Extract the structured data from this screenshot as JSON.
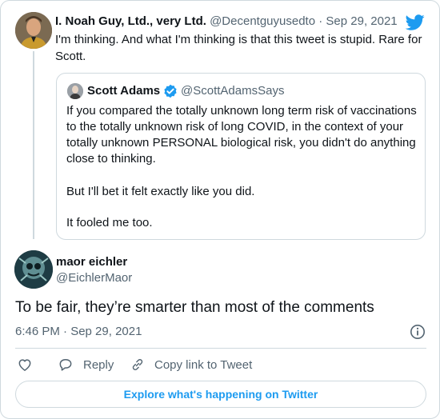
{
  "thread_tweet": {
    "author_name": "I. Noah Guy, Ltd., very Ltd.",
    "author_handle": "@Decentguyusedto",
    "separator": "·",
    "date": "Sep 29, 2021",
    "text": "I'm thinking. And what I'm thinking is that this tweet is stupid. Rare for Scott."
  },
  "quoted_tweet": {
    "author_name": "Scott Adams",
    "author_handle": "@ScottAdamsSays",
    "paragraphs": [
      "If you compared the totally unknown long term risk of vaccinations to the totally unknown risk of long COVID, in the context of your totally unknown PERSONAL biological risk, you didn't do anything close to thinking.",
      "But I'll bet it felt exactly like you did.",
      "It fooled me too."
    ]
  },
  "main_tweet": {
    "author_name": "maor eichler",
    "author_handle": "@EichlerMaor",
    "text": "To be fair, they’re smarter than most of the comments",
    "timestamp": "6:46 PM · Sep 29, 2021"
  },
  "actions": {
    "reply": "Reply",
    "copy_link": "Copy link to Tweet"
  },
  "explore_button": "Explore what's happening on Twitter",
  "icons": {
    "brand": "twitter-bird-icon",
    "verified": "verified-badge-icon",
    "info": "info-icon",
    "like": "heart-icon",
    "reply": "reply-icon",
    "link": "link-icon"
  },
  "colors": {
    "brand_blue": "#1d9bf0",
    "text": "#0f1419",
    "muted": "#536471",
    "border": "#cfd9de"
  }
}
